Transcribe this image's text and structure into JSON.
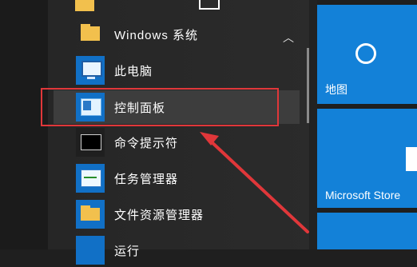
{
  "group": {
    "title": "Windows 系统",
    "expanded": true
  },
  "items": [
    {
      "label": "此电脑",
      "icon": "computer-icon"
    },
    {
      "label": "控制面板",
      "icon": "control-panel-icon",
      "highlighted": true
    },
    {
      "label": "命令提示符",
      "icon": "cmd-icon"
    },
    {
      "label": "任务管理器",
      "icon": "task-manager-icon"
    },
    {
      "label": "文件资源管理器",
      "icon": "file-explorer-icon"
    },
    {
      "label": "运行",
      "icon": "run-icon"
    }
  ],
  "tiles": [
    {
      "label": "地图",
      "icon": "map-pin-icon"
    },
    {
      "label": "Microsoft Store",
      "icon": "store-icon"
    }
  ],
  "colors": {
    "accent": "#1381d8",
    "highlight": "#e0373a"
  }
}
